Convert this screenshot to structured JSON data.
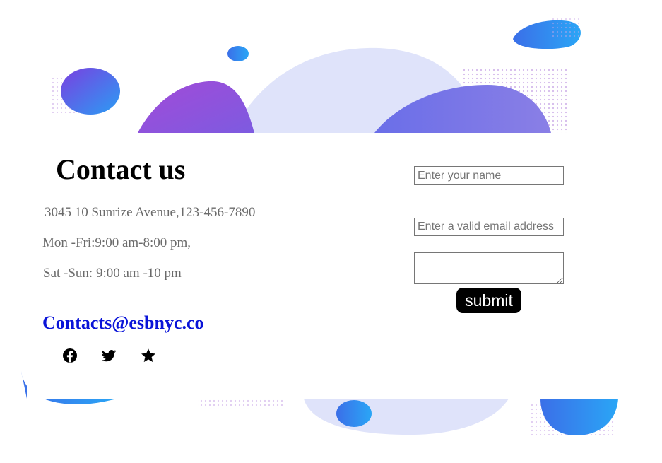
{
  "contact": {
    "title": "Contact us",
    "address": "3045 10 Sunrize Avenue,123-456-7890",
    "hours_weekday": "Mon -Fri:9:00 am-8:00 pm,",
    "hours_weekend": "Sat -Sun: 9:00 am -10 pm",
    "email": "Contacts@esbnyc.co"
  },
  "social": [
    "facebook-icon",
    "twitter-icon",
    "star-icon"
  ],
  "form": {
    "name_placeholder": "Enter your name",
    "email_placeholder": "Enter a valid email address",
    "message_placeholder": "",
    "submit_label": "submit"
  },
  "colors": {
    "link": "#0a14d8",
    "info_text": "#6b6b6b",
    "button_bg": "#000000",
    "blob_blue": "#2a9df4",
    "blob_purple": "#9b4fd6",
    "blob_lavender": "#dfe3fa"
  }
}
